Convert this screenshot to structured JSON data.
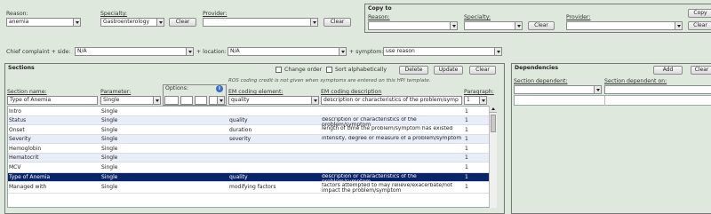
{
  "top": {
    "reason_label": "Reason:",
    "reason_value": "anemia",
    "specialty_label": "Specialty:",
    "specialty_value": "Gastroenterology",
    "clear1": "Clear",
    "provider_label": "Provider:",
    "provider_value": "",
    "clear2": "Clear"
  },
  "copy_to": {
    "title": "Copy to",
    "reason_label": "Reason:",
    "specialty_label": "Specialty:",
    "provider_label": "Provider:",
    "copy": "Copy",
    "clear_a": "Clear",
    "clear_b": "Clear",
    "clear_c": "Clear"
  },
  "filter": {
    "cc_label": "Chief complaint + side:",
    "cc_value": "N/A",
    "loc_label": "+ location:",
    "loc_value": "N/A",
    "sym_label": "+ symptom:",
    "sym_value": "use reason"
  },
  "sections": {
    "title": "Sections",
    "change_order": "Change order",
    "sort_alpha": "Sort alphabetically",
    "delete": "Delete",
    "update": "Update",
    "clear": "Clear",
    "ros_note": "ROS coding credit is not given when symptoms are entered on this HPI template.",
    "options_label": "Options:",
    "col_name": "Section name:",
    "col_param": "Parameter:",
    "col_em": "EM coding element:",
    "col_desc": "EM coding description",
    "col_para": "Paragraph:",
    "edit_name": "Type of Anemia",
    "edit_param": "Single",
    "edit_em": "quality",
    "edit_desc": "description or characteristics of the problem/symp",
    "edit_para": "1",
    "rows": [
      {
        "name": "Intro",
        "param": "Single",
        "em": "",
        "desc": "",
        "para": "1"
      },
      {
        "name": "Status",
        "param": "Single",
        "em": "quality",
        "desc": "description or characteristics of the problem/symptom",
        "para": "1"
      },
      {
        "name": "Onset",
        "param": "Single",
        "em": "duration",
        "desc": "length of time the problem/symptom has existed",
        "para": "1"
      },
      {
        "name": "Severity",
        "param": "Single",
        "em": "severity",
        "desc": "intensity, degree or measure of a problem/symptom",
        "para": "1"
      },
      {
        "name": "Hemoglobin",
        "param": "Single",
        "em": "",
        "desc": "",
        "para": "1"
      },
      {
        "name": "Hematocrit",
        "param": "Single",
        "em": "",
        "desc": "",
        "para": "1"
      },
      {
        "name": "MCV",
        "param": "Single",
        "em": "",
        "desc": "",
        "para": "1"
      },
      {
        "name": "Type of Anemia",
        "param": "Single",
        "em": "quality",
        "desc": "description or characteristics of the problem/symptom",
        "para": "1"
      },
      {
        "name": "Managed with",
        "param": "Single",
        "em": "modifying factors",
        "desc": "factors attempted to may relieve/exacerbate/not impact the problem/symptom",
        "para": "1"
      }
    ]
  },
  "deps": {
    "title": "Dependencies",
    "add": "Add",
    "clear": "Clear",
    "col_dep": "Section dependent:",
    "col_on": "Section dependent on:"
  }
}
